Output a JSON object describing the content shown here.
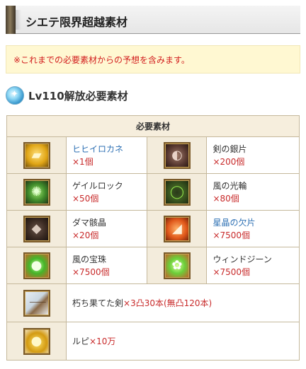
{
  "header": {
    "title": "シエテ限界超越素材"
  },
  "notice": {
    "text": "※これまでの必要素材からの予想を含みます。"
  },
  "section": {
    "title": "Lv110解放必要素材",
    "icon": "wind-orb-icon"
  },
  "table": {
    "header": "必要素材",
    "rows": [
      [
        {
          "name": "ヒヒイロカネ",
          "qty": "×1個",
          "icon": "hihiirokane-icon",
          "link": true
        },
        {
          "name": "剣の銀片",
          "qty": "×200個",
          "icon": "silver-sword-fragment-icon",
          "link": false
        }
      ],
      [
        {
          "name": "ゲイルロック",
          "qty": "×50個",
          "icon": "gale-rock-icon",
          "link": false
        },
        {
          "name": "風の光輪",
          "qty": "×80個",
          "icon": "wind-halo-icon",
          "link": false
        }
      ],
      [
        {
          "name": "ダマ骸晶",
          "qty": "×20個",
          "icon": "damascus-crystal-icon",
          "link": false
        },
        {
          "name": "星晶の欠片",
          "qty": "×7500個",
          "icon": "star-crystal-fragment-icon",
          "link": true
        }
      ],
      [
        {
          "name": "風の宝珠",
          "qty": "×7500個",
          "icon": "wind-orb-item-icon",
          "link": false
        },
        {
          "name": "ウィンドジーン",
          "qty": "×7500個",
          "icon": "wind-gene-icon",
          "link": false
        }
      ]
    ],
    "sword": {
      "name": "朽ち果てた剣",
      "qty": "×3凸30本(無凸120本)",
      "icon": "decayed-sword-icon"
    },
    "rupie": {
      "name": "ルピ",
      "qty": "×10万",
      "icon": "rupie-coins-icon"
    }
  },
  "colors": {
    "accent_red": "#c82a2a",
    "link_blue": "#2c6fb3",
    "notice_bg": "#fff8d2",
    "border": "#c5b89b"
  }
}
